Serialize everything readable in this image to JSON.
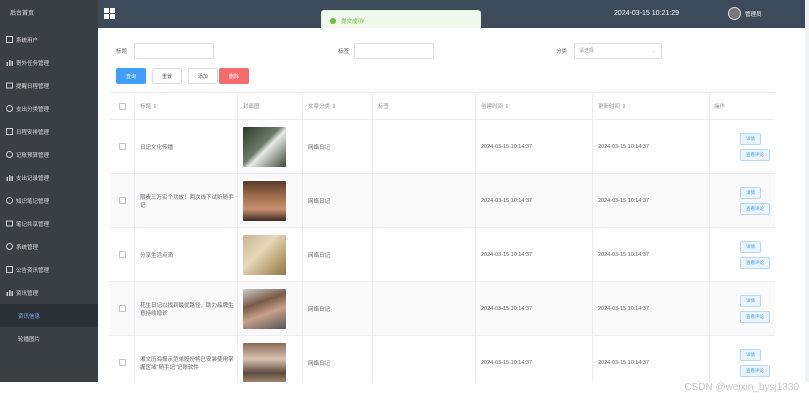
{
  "sidebar": {
    "title": "后台首页",
    "items": [
      {
        "label": "系统用户"
      },
      {
        "label": "寄外任务管理"
      },
      {
        "label": "提醒日程管理"
      },
      {
        "label": "支出分类管理"
      },
      {
        "label": "日程安排管理"
      },
      {
        "label": "记账预算管理"
      },
      {
        "label": "支出记录管理"
      },
      {
        "label": "知识笔记管理"
      },
      {
        "label": "笔记共享管理"
      },
      {
        "label": "系统管理"
      },
      {
        "label": "公告资讯管理"
      },
      {
        "label": "资讯管理"
      },
      {
        "label": "资讯信息"
      },
      {
        "label": "轮播图片"
      }
    ]
  },
  "header": {
    "datetime": "2024-03-15 10:21:29",
    "user": "管理员",
    "toast": "提交成功!"
  },
  "filters": {
    "title_label": "标题",
    "tag_label": "标签",
    "category_label": "分类",
    "category_placeholder": "请选择"
  },
  "buttons": {
    "query": "查询",
    "reset": "重置",
    "add": "添加",
    "delete": "删除"
  },
  "table": {
    "headers": [
      "标题 ⇕",
      "封面图",
      "文章分类 ⇕",
      "标签",
      "创建时间 ⇕",
      "更新时间 ⇕",
      "操作"
    ],
    "rows": [
      {
        "title": "日记文化传播",
        "category": "网络日记",
        "tag": "",
        "created": "2024-03-15 10:14:37",
        "updated": "2024-03-15 10:14:37"
      },
      {
        "title": "限责三万实个功放！两次线下试听随手记",
        "category": "网络日记",
        "tag": "",
        "created": "2024-03-15 10:14:37",
        "updated": "2024-03-15 10:14:37"
      },
      {
        "title": "分享生活点滴",
        "category": "网络日记",
        "tag": "",
        "created": "2024-03-15 10:14:37",
        "updated": "2024-03-15 10:14:37"
      },
      {
        "title": "花生日记以找到最优路径，助力品牌生意持续增长",
        "category": "网络日记",
        "tag": "",
        "created": "2024-03-15 10:14:37",
        "updated": "2024-03-15 10:14:37"
      },
      {
        "title": "湘文历海报示范单股份将已安装使用掌握区域\"随手记\"记账软件",
        "category": "网络日记",
        "tag": "",
        "created": "2024-03-15 10:14:37",
        "updated": "2024-03-15 10:14:37"
      }
    ],
    "action_detail": "详情",
    "action_comment": "查看评论"
  },
  "watermark": "CSDN @weixin_bysj1330"
}
